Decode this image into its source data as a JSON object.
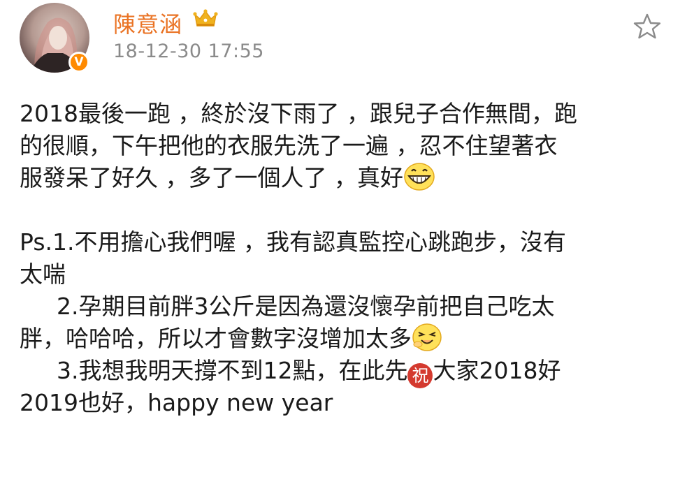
{
  "header": {
    "username": "陳意涵",
    "timestamp": "18-12-30 17:55",
    "verified_badge": "V",
    "icons": {
      "avatar": "user-avatar",
      "crown": "crown-icon",
      "star": "star-outline-icon"
    }
  },
  "post": {
    "l1": "2018最後一跑 ，終於沒下雨了 ，跟兒子合作無間，跑",
    "l2": "的很順，下午把他的衣服先洗了一遍 ，忍不住望著衣",
    "l3": "服發呆了好久 ，多了一個人了 ，真好",
    "l4": "Ps.1.不用擔心我們喔 ，我有認真監控心跳跑步，沒有",
    "l5": "太喘",
    "l6": "2.孕期目前胖3公斤是因為還沒懷孕前把自己吃太",
    "l7": "胖，哈哈哈，所以才會數字沒增加太多",
    "l8a": "3.我想我明天撐不到12點，在此先",
    "l8zhu": "祝",
    "l8b": "大家2018好",
    "l9": "2019也好，happy new year"
  },
  "colors": {
    "username": "#ea7324",
    "timestamp": "#8a8a8a",
    "verified": "#ff8a00",
    "crown": "#f0b21e",
    "text": "#1a1a1a",
    "zhu_badge": "#d43a2f"
  }
}
